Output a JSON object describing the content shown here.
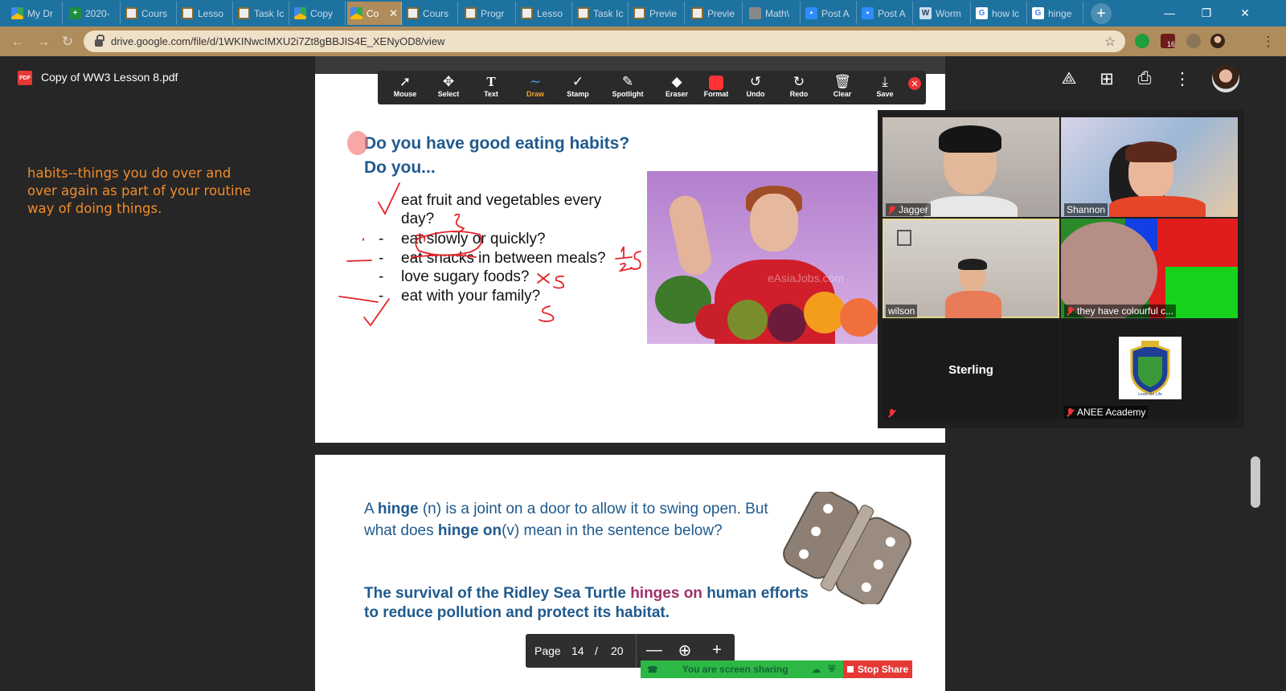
{
  "browser": {
    "tabs": [
      {
        "label": "My Dr",
        "icon": "google-drive-icon"
      },
      {
        "label": "2020-",
        "icon": "google-sheets-icon"
      },
      {
        "label": "Cours",
        "icon": "document-icon"
      },
      {
        "label": "Lesso",
        "icon": "document-icon"
      },
      {
        "label": "Task Ic",
        "icon": "document-icon"
      },
      {
        "label": "Copy",
        "icon": "google-drive-icon"
      },
      {
        "label": "Co",
        "icon": "google-drive-icon",
        "active": true
      },
      {
        "label": "Cours",
        "icon": "document-icon"
      },
      {
        "label": "Progr",
        "icon": "document-icon"
      },
      {
        "label": "Lesso",
        "icon": "document-icon"
      },
      {
        "label": "Task Ic",
        "icon": "document-icon"
      },
      {
        "label": "Previe",
        "icon": "document-icon"
      },
      {
        "label": "Previe",
        "icon": "document-icon"
      },
      {
        "label": "Math\\",
        "icon": "globe-icon"
      },
      {
        "label": "Post A",
        "icon": "zoom-icon"
      },
      {
        "label": "Post A",
        "icon": "zoom-icon"
      },
      {
        "label": "Worm",
        "icon": "book-icon"
      },
      {
        "label": "how lc",
        "icon": "google-icon"
      },
      {
        "label": "hinge",
        "icon": "google-icon"
      }
    ],
    "url": "drive.google.com/file/d/1WKINwcIMXU2i7Zt8gBBJIS4E_XENyOD8/view",
    "extension_badge": "16"
  },
  "drive": {
    "pdf_badge": "PDF",
    "file_title": "Copy of WW3 Lesson 8.pdf"
  },
  "note": {
    "text": "habits--things you do over and over again as part of your routine way of doing things."
  },
  "annotate_toolbar": {
    "tools": [
      {
        "label": "Mouse",
        "icon": "mouse-pointer-icon"
      },
      {
        "label": "Select",
        "icon": "move-arrows-icon"
      },
      {
        "label": "Text",
        "icon": "text-T-icon"
      },
      {
        "label": "Draw",
        "icon": "squiggle-icon",
        "active": true
      },
      {
        "label": "Stamp",
        "icon": "checkmark-icon"
      },
      {
        "label": "Spotlight",
        "icon": "wand-icon"
      },
      {
        "label": "Eraser",
        "icon": "eraser-icon"
      },
      {
        "label": "Format",
        "icon": "red-swatch-icon"
      },
      {
        "label": "Undo",
        "icon": "undo-icon"
      },
      {
        "label": "Redo",
        "icon": "redo-icon"
      },
      {
        "label": "Clear",
        "icon": "trash-icon"
      },
      {
        "label": "Save",
        "icon": "save-icon"
      }
    ],
    "accent": "#F5A623"
  },
  "slide1": {
    "question": "Do you have good eating habits?",
    "subquestion": "Do you...",
    "items": [
      {
        "bullet": "",
        "text": "eat fruit and vegetables every"
      },
      {
        "bullet": "",
        "text": "day?"
      },
      {
        "bullet": "-",
        "text": "eat slowly or quickly?"
      },
      {
        "bullet": "-",
        "text": "eat snacks in between meals?"
      },
      {
        "bullet": "-",
        "text": "love sugary foods?"
      },
      {
        "bullet": "-",
        "text": "eat with your family?"
      }
    ],
    "image_watermark": "eAsiaJobs.com"
  },
  "slide2": {
    "p1_a": "A ",
    "p1_b": "hinge",
    "p1_c": " (n) is a joint on a door to allow it to swing open. But what does ",
    "p1_d": "hinge on",
    "p1_e": "(v) mean in the sentence below?",
    "p2_a": "The survival of the Ridley Sea Turtle ",
    "p2_b": "hinges on",
    "p2_c": " human efforts to reduce pollution and protect its habitat."
  },
  "pagebar": {
    "label": "Page",
    "current": "14",
    "separator": "/",
    "total": "20"
  },
  "sharebar": {
    "status": "You are screen sharing",
    "stop": "Stop Share",
    "green": "#2db744",
    "red": "#e53935"
  },
  "zoom": {
    "participants": [
      {
        "name": "Jagger",
        "muted": true
      },
      {
        "name": "Shannon",
        "muted": false
      },
      {
        "name": "wilson",
        "muted": false,
        "active_speaker": true
      },
      {
        "name": "they have colourful c...",
        "muted": true
      },
      {
        "name": "Sterling",
        "muted": true,
        "video_off": true
      },
      {
        "name": "ANEE Academy",
        "muted": true
      }
    ],
    "logo_text": "Learn for Life"
  }
}
